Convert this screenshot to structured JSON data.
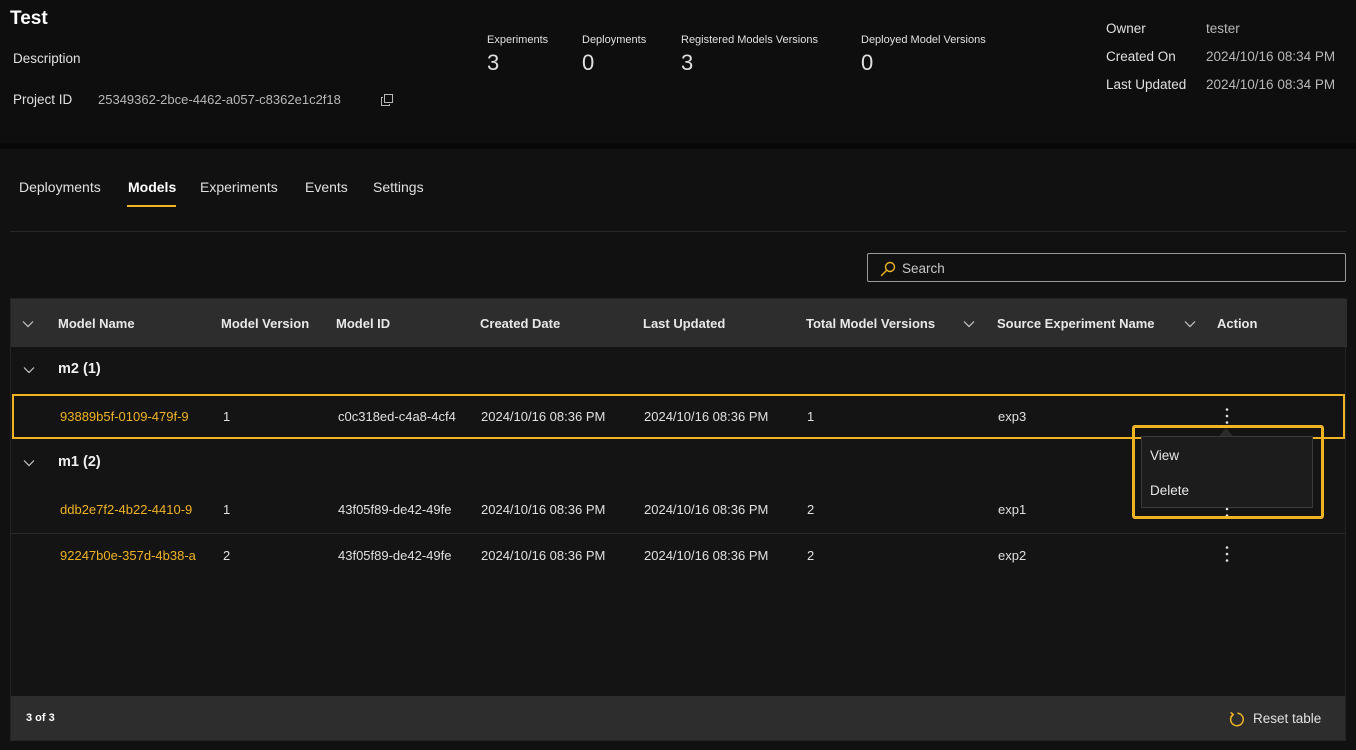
{
  "project": {
    "title": "Test",
    "description_label": "Description",
    "project_id_label": "Project ID",
    "project_id": "25349362-2bce-4462-a057-c8362e1c2f18"
  },
  "stats": [
    {
      "label": "Experiments",
      "value": "3"
    },
    {
      "label": "Deployments",
      "value": "0"
    },
    {
      "label": "Registered Models Versions",
      "value": "3"
    },
    {
      "label": "Deployed Model Versions",
      "value": "0"
    }
  ],
  "meta": {
    "owner_label": "Owner",
    "owner": "tester",
    "created_label": "Created On",
    "created": "2024/10/16 08:34 PM",
    "updated_label": "Last Updated",
    "updated": "2024/10/16 08:34 PM"
  },
  "tabs": [
    {
      "label": "Deployments"
    },
    {
      "label": "Models",
      "active": true
    },
    {
      "label": "Experiments"
    },
    {
      "label": "Events"
    },
    {
      "label": "Settings"
    }
  ],
  "search": {
    "placeholder": "Search"
  },
  "table": {
    "columns": {
      "model_name": "Model Name",
      "model_version": "Model Version",
      "model_id": "Model ID",
      "created_date": "Created Date",
      "last_updated": "Last Updated",
      "total_versions": "Total Model Versions",
      "source_experiment": "Source Experiment Name",
      "action": "Action"
    },
    "groups": [
      {
        "label": "m2 (1)",
        "rows": [
          {
            "name": "93889b5f-0109-479f-9",
            "version": "1",
            "id": "c0c318ed-c4a8-4cf4",
            "created": "2024/10/16 08:36 PM",
            "updated": "2024/10/16 08:36 PM",
            "total": "1",
            "source": "exp3"
          }
        ]
      },
      {
        "label": "m1 (2)",
        "rows": [
          {
            "name": "ddb2e7f2-4b22-4410-9",
            "version": "1",
            "id": "43f05f89-de42-49fe",
            "created": "2024/10/16 08:36 PM",
            "updated": "2024/10/16 08:36 PM",
            "total": "2",
            "source": "exp1"
          },
          {
            "name": "92247b0e-357d-4b38-a",
            "version": "2",
            "id": "43f05f89-de42-49fe",
            "created": "2024/10/16 08:36 PM",
            "updated": "2024/10/16 08:36 PM",
            "total": "2",
            "source": "exp2"
          }
        ]
      }
    ],
    "count": "3 of 3",
    "reset_label": "Reset table"
  },
  "action_menu": {
    "items": [
      "View",
      "Delete"
    ]
  },
  "colors": {
    "accent": "#f0b323",
    "background": "#111111",
    "header_bg": "#0e0e0e",
    "table_header": "#2d2d2d"
  },
  "icons": [
    "copy-icon",
    "search-icon",
    "chevron-down-icon",
    "kebab-menu-icon",
    "reset-icon"
  ]
}
